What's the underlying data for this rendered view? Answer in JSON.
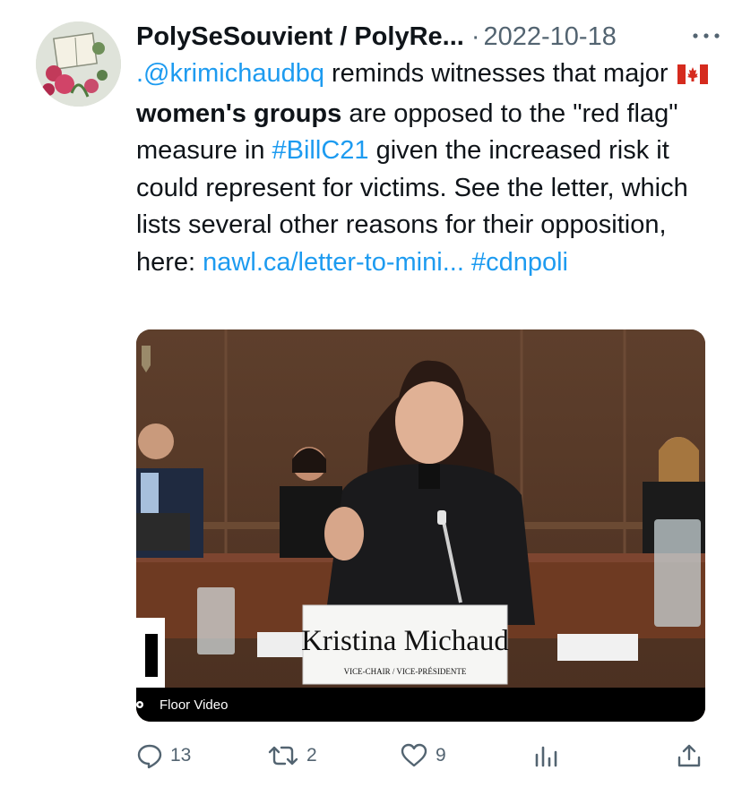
{
  "tweet": {
    "author_name": "PolySeSouvient / PolyRe...",
    "separator": "·",
    "date": "2022-10-18",
    "mention": ".@krimichaudbq",
    "text_1": " reminds witnesses that major ",
    "flag_emoji": "canada-flag-icon",
    "bold_phrase": "women's groups",
    "text_2": " are opposed to the \"red flag\" measure in ",
    "hashtag_1": "#BillC21",
    "text_3": " given the increased risk it could represent for victims. See the letter, which lists several other reasons for their opposition, here: ",
    "link": "nawl.ca/​letter-to-mini...",
    "text_4": " ",
    "hashtag_2": "#cdnpoli"
  },
  "media": {
    "nameplate_name": "Kristina Michaud",
    "nameplate_title": "VICE-CHAIR / VICE-PRÉSIDENTE",
    "caption": "Floor Video"
  },
  "actions": {
    "replies": "13",
    "retweets": "2",
    "likes": "9"
  },
  "colors": {
    "link": "#1d9bf0",
    "muted": "#536471",
    "text": "#0f1419"
  }
}
